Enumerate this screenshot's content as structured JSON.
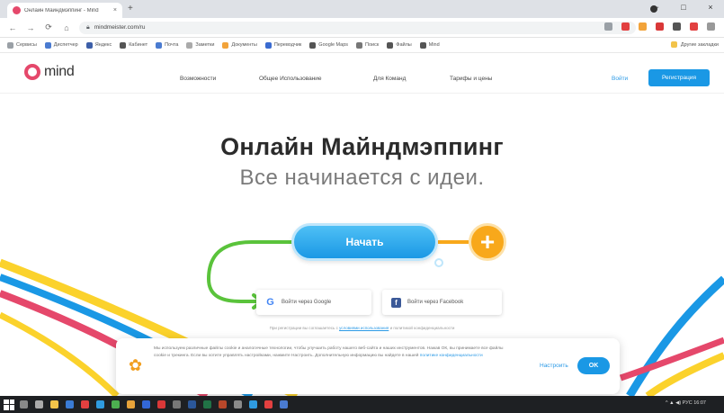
{
  "browser": {
    "tab_title": "Онлайн Майндмэппинг - Mind",
    "tab_close": "×",
    "new_tab": "+",
    "url": "mindmeister.com/ru",
    "controls": [
      "−",
      "□",
      "×"
    ],
    "bookmarks": [
      "Сервисы",
      "Диспетчер",
      "Яндекс",
      "Кабинет",
      "Почта",
      "Заметки",
      "Документы",
      "Переводчик",
      "Google Maps",
      "Поиск",
      "Файлы",
      "Mind"
    ],
    "bookmarks_right": "Другие закладки"
  },
  "header": {
    "logo_text": "mind",
    "nav": [
      "Возможности",
      "Общее Использование",
      "Для Команд",
      "Тарифы и цены"
    ],
    "login": "Войти",
    "register": "Регистрация"
  },
  "hero": {
    "title": "Онлайн Майндмэппинг",
    "subtitle": "Все начинается с идеи.",
    "start_button": "Начать",
    "plus": "+"
  },
  "social": {
    "google_label": "Войти через Google",
    "facebook_label": "Войти через Facebook"
  },
  "legal": {
    "prefix": "При регистрации вы соглашаетесь с",
    "link": "условиями использования",
    "suffix": "и политикой конфиденциальности"
  },
  "cookie": {
    "text": "Мы используем различные файлы cookie и аналогичные технологии, чтобы улучшить работу нашего веб-сайта и наших инструментов. Нажав ОК, вы принимаете все файлы cookie и трекинга. Если вы хотите управлять настройками, нажмите Настроить. Дополнительную информацию вы найдете в нашей",
    "link": "политике конфиденциальности",
    "more": "Настроить",
    "ok": "OK"
  },
  "taskbar": {
    "tray": "^ ▲ ◀) РУС 16:07"
  },
  "colors": {
    "brand_blue": "#1a98e5",
    "brand_pink": "#e5486b",
    "accent_orange": "#f8a81b",
    "accent_green": "#5ac33b",
    "accent_yellow": "#fbd22c"
  }
}
